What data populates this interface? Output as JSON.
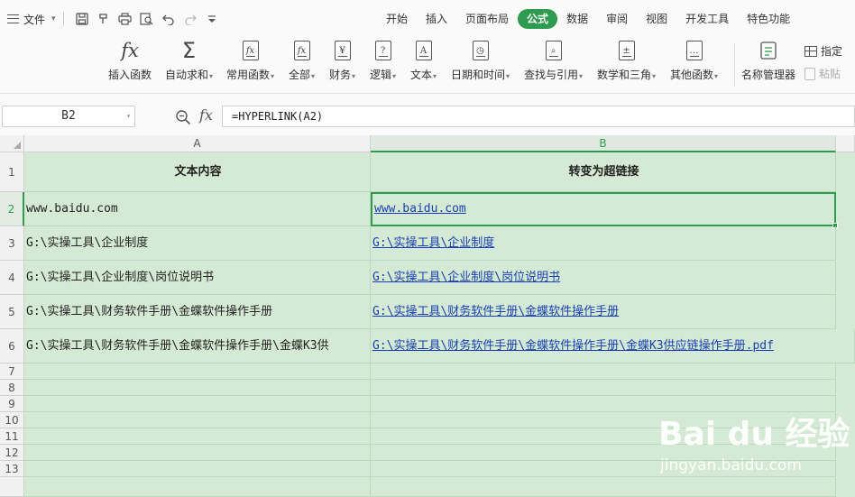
{
  "menubar": {
    "file_label": "文件",
    "tabs": [
      "开始",
      "插入",
      "页面布局",
      "公式",
      "数据",
      "审阅",
      "视图",
      "开发工具",
      "特色功能"
    ],
    "active_tab": "公式",
    "accent_color": "#2e9b4f"
  },
  "ribbon": {
    "buttons": [
      {
        "label": "插入函数",
        "icon": "fx-icon"
      },
      {
        "label": "自动求和",
        "icon": "sigma-icon",
        "dropdown": true
      },
      {
        "label": "常用函数",
        "icon": "star-function-icon",
        "dropdown": true
      },
      {
        "label": "全部",
        "icon": "function-book-icon",
        "dropdown": true
      },
      {
        "label": "财务",
        "icon": "yen-book-icon",
        "dropdown": true
      },
      {
        "label": "逻辑",
        "icon": "question-book-icon",
        "dropdown": true
      },
      {
        "label": "文本",
        "icon": "text-book-icon",
        "dropdown": true
      },
      {
        "label": "日期和时间",
        "icon": "clock-book-icon",
        "dropdown": true
      },
      {
        "label": "查找与引用",
        "icon": "search-book-icon",
        "dropdown": true
      },
      {
        "label": "数学和三角",
        "icon": "math-book-icon",
        "dropdown": true
      },
      {
        "label": "其他函数",
        "icon": "more-book-icon",
        "dropdown": true
      },
      {
        "label": "名称管理器",
        "icon": "name-manager-icon"
      }
    ],
    "specify_label": "指定",
    "paste_label": "粘贴"
  },
  "formula_bar": {
    "name_box": "B2",
    "formula": "=HYPERLINK(A2)"
  },
  "sheet": {
    "columns": [
      "A",
      "B"
    ],
    "rows": [
      "1",
      "2",
      "3",
      "4",
      "5",
      "6",
      "7",
      "8",
      "9",
      "10",
      "11",
      "12",
      "13"
    ],
    "header_a": "文本内容",
    "header_b": "转变为超链接",
    "col_a": [
      "www.baidu.com",
      "G:\\实操工具\\企业制度",
      "G:\\实操工具\\企业制度\\岗位说明书",
      "G:\\实操工具\\财务软件手册\\金蝶软件操作手册",
      "G:\\实操工具\\财务软件手册\\金蝶软件操作手册\\金蝶K3供"
    ],
    "col_b": [
      "www.baidu.com",
      "G:\\实操工具\\企业制度",
      "G:\\实操工具\\企业制度\\岗位说明书",
      "G:\\实操工具\\财务软件手册\\金蝶软件操作手册",
      "G:\\实操工具\\财务软件手册\\金蝶软件操作手册\\金蝶K3供应链操作手册.pdf"
    ],
    "selected_cell": "B2"
  },
  "watermark": {
    "logo": "Bai du 经验",
    "url": "jingyan.baidu.com"
  }
}
